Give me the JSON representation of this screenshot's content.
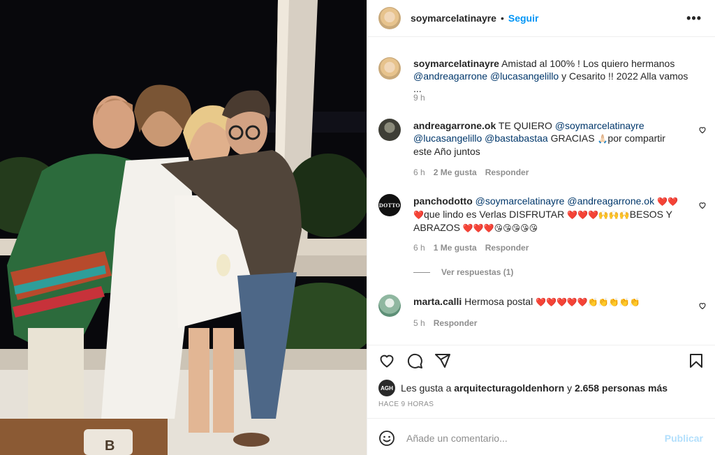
{
  "post": {
    "author": "soymarcelatinayre",
    "dot": "•",
    "follow_label": "Seguir",
    "more_icon": "more-horizontal-icon"
  },
  "caption": {
    "user": "soymarcelatinayre",
    "text_1": "Amistad al 100% ! Los quiero hermanos",
    "mention_1": "@andreagarrone",
    "mention_2": "@lucasangelillo",
    "text_2": "y Cesarito !! 2022 Alla vamos ...",
    "time": "9 h"
  },
  "comments": [
    {
      "user": "andreagarrone.ok",
      "text_a": "TE QUIERO",
      "mention_a": "@soymarcelatinayre",
      "mention_b": "@lucasangelillo",
      "mention_c": "@bastabastaa",
      "text_b": "GRACIAS",
      "emoji_a": "🙏🏻",
      "text_c": "por compartir este Año juntos",
      "time": "6 h",
      "likes": "2 Me gusta",
      "reply": "Responder"
    },
    {
      "user": "panchodotto",
      "avatar_text": "DOTTO",
      "mention_a": "@soymarcelatinayre",
      "mention_b": "@andreagarrone.ok",
      "emoji_a": "❤️❤️",
      "emoji_b": "❤️",
      "text_a": "que lindo es Verlas DISFRUTAR",
      "emoji_c": "❤️❤️❤️🙌🙌🙌",
      "text_b": "BESOS Y ABRAZOS",
      "emoji_d": "❤️❤️❤️😘😘😘😘😘",
      "time": "6 h",
      "likes": "1 Me gusta",
      "reply": "Responder",
      "view_replies": "Ver respuestas (1)"
    },
    {
      "user": "marta.calli",
      "text_a": "Hermosa postal",
      "emoji_a": "❤️❤️❤️❤️❤️👏👏👏👏👏",
      "time": "5 h",
      "reply": "Responder"
    }
  ],
  "actions": {
    "like_icon": "heart-icon",
    "comment_icon": "comment-icon",
    "share_icon": "send-icon",
    "save_icon": "bookmark-icon"
  },
  "likes": {
    "avatar_text": "AGH",
    "prefix": "Les gusta a",
    "user": "arquitecturagoldenhorn",
    "connector": "y",
    "others": "2.658 personas más"
  },
  "timestamp": "HACE 9 HORAS",
  "add_comment": {
    "emoji_icon": "smiley-icon",
    "placeholder": "Añade un comentario...",
    "post_label": "Publicar"
  },
  "colors": {
    "accent": "#0095f6",
    "mention": "#00376b",
    "muted": "#8e8e8e",
    "post_disabled": "#b2dffc"
  }
}
